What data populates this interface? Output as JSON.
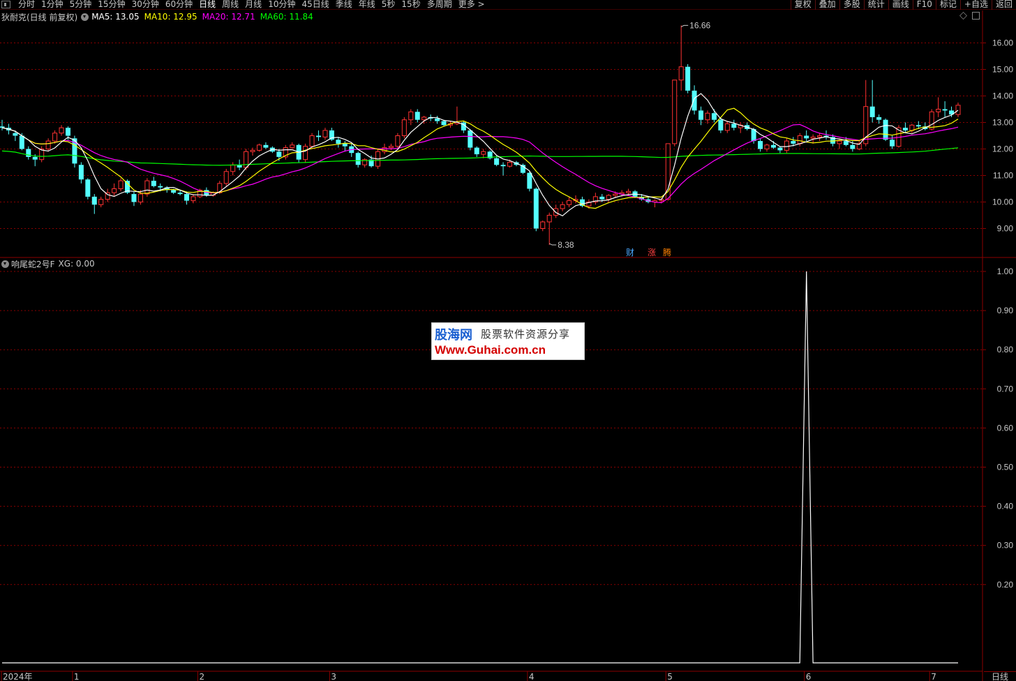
{
  "toolbar": {
    "timeframes": [
      "分时",
      "1分钟",
      "5分钟",
      "15分钟",
      "30分钟",
      "60分钟",
      "日线",
      "周线",
      "月线",
      "10分钟",
      "45日线",
      "季线",
      "年线",
      "5秒",
      "15秒",
      "多周期",
      "更多 >"
    ],
    "active_timeframe": "日线",
    "right_tools": [
      "复权",
      "叠加",
      "多股",
      "统计",
      "画线",
      "F10",
      "标记",
      "+自选",
      "返回"
    ]
  },
  "main_panel": {
    "stock_title": "狄耐克(日线 前复权)",
    "ma_legend": [
      {
        "label": "MA5: 13.05",
        "color": "#ffffff"
      },
      {
        "label": "MA10: 12.95",
        "color": "#ffff00"
      },
      {
        "label": "MA20: 12.71",
        "color": "#ff00ff"
      },
      {
        "label": "MA60: 11.84",
        "color": "#00ff00"
      }
    ],
    "high_label": "16.66",
    "low_label": "8.38",
    "event_marks": [
      {
        "text": "财",
        "color": "#4aa8ff"
      },
      {
        "text": "涨",
        "color": "#ff4040"
      },
      {
        "text": "腾",
        "color": "#ff8000"
      }
    ]
  },
  "sub_panel": {
    "indicator_title": "响尾蛇2号F",
    "indicator_value": "XG: 0.00"
  },
  "watermark": {
    "logo": "股海网",
    "subtitle": "股票软件资源分享",
    "url": "Www.Guhai.com.cn"
  },
  "bottom_tab": "日线",
  "colors": {
    "up": "#ff3232",
    "down": "#54ffff",
    "ma5": "#ffffff",
    "ma10": "#ffff00",
    "ma20": "#ff00ff",
    "ma60": "#00ff00",
    "grid": "#8b0000",
    "axis": "#c8c8c8"
  },
  "chart_data": [
    {
      "type": "candlestick",
      "title": "狄耐克(日线 前复权)",
      "ylim": [
        8.0,
        16.9
      ],
      "y_ticks": [
        9.0,
        10.0,
        11.0,
        12.0,
        13.0,
        14.0,
        15.0,
        16.0
      ],
      "grid": true,
      "candles": [
        [
          12.85,
          13.1,
          12.7,
          12.8
        ],
        [
          12.8,
          12.95,
          12.55,
          12.7
        ],
        [
          12.6,
          12.7,
          12.3,
          12.5
        ],
        [
          12.5,
          12.6,
          11.95,
          12.0
        ],
        [
          12.0,
          12.1,
          11.6,
          11.7
        ],
        [
          11.7,
          11.8,
          11.35,
          11.6
        ],
        [
          11.6,
          12.1,
          11.5,
          12.0
        ],
        [
          12.0,
          12.4,
          11.9,
          12.3
        ],
        [
          12.3,
          12.7,
          12.2,
          12.6
        ],
        [
          12.6,
          12.9,
          12.5,
          12.8
        ],
        [
          12.8,
          12.85,
          12.35,
          12.5
        ],
        [
          12.4,
          12.5,
          11.3,
          11.45
        ],
        [
          11.4,
          11.5,
          10.7,
          10.85
        ],
        [
          10.85,
          10.9,
          10.1,
          10.2
        ],
        [
          10.2,
          10.3,
          9.55,
          9.9
        ],
        [
          9.9,
          10.2,
          9.8,
          10.1
        ],
        [
          10.1,
          10.5,
          10.0,
          10.35
        ],
        [
          10.35,
          10.7,
          10.2,
          10.5
        ],
        [
          10.5,
          10.9,
          10.4,
          10.8
        ],
        [
          10.8,
          10.85,
          10.3,
          10.35
        ],
        [
          10.3,
          10.4,
          9.85,
          10.0
        ],
        [
          10.0,
          10.45,
          9.9,
          10.3
        ],
        [
          10.3,
          10.9,
          10.2,
          10.8
        ],
        [
          10.8,
          10.95,
          10.55,
          10.6
        ],
        [
          10.6,
          10.7,
          10.4,
          10.55
        ],
        [
          10.55,
          10.6,
          10.35,
          10.45
        ],
        [
          10.45,
          10.5,
          10.3,
          10.35
        ],
        [
          10.35,
          10.45,
          10.25,
          10.3
        ],
        [
          10.3,
          10.4,
          9.9,
          10.05
        ],
        [
          10.05,
          10.3,
          9.95,
          10.2
        ],
        [
          10.2,
          10.5,
          10.15,
          10.45
        ],
        [
          10.45,
          10.55,
          10.2,
          10.25
        ],
        [
          10.25,
          10.4,
          10.2,
          10.35
        ],
        [
          10.35,
          10.8,
          10.3,
          10.7
        ],
        [
          10.7,
          11.25,
          10.6,
          11.15
        ],
        [
          11.15,
          11.5,
          11.0,
          11.4
        ],
        [
          11.4,
          11.6,
          11.2,
          11.3
        ],
        [
          11.3,
          12.0,
          11.2,
          11.9
        ],
        [
          11.9,
          12.05,
          11.75,
          11.95
        ],
        [
          11.95,
          12.2,
          11.9,
          12.15
        ],
        [
          12.15,
          12.25,
          12.0,
          12.05
        ],
        [
          12.05,
          12.1,
          11.85,
          11.9
        ],
        [
          11.9,
          12.0,
          11.55,
          11.7
        ],
        [
          11.7,
          12.15,
          11.6,
          12.05
        ],
        [
          12.05,
          12.25,
          12.0,
          12.15
        ],
        [
          12.15,
          12.2,
          11.5,
          11.6
        ],
        [
          11.6,
          12.2,
          11.5,
          12.1
        ],
        [
          12.1,
          12.6,
          12.0,
          12.5
        ],
        [
          12.5,
          12.7,
          12.3,
          12.45
        ],
        [
          12.45,
          12.8,
          12.35,
          12.7
        ],
        [
          12.7,
          12.8,
          12.3,
          12.35
        ],
        [
          12.35,
          12.45,
          12.05,
          12.2
        ],
        [
          12.2,
          12.3,
          11.9,
          12.1
        ],
        [
          12.1,
          12.2,
          11.7,
          11.85
        ],
        [
          11.85,
          11.9,
          11.3,
          11.4
        ],
        [
          11.4,
          11.65,
          11.3,
          11.6
        ],
        [
          11.6,
          11.75,
          11.3,
          11.35
        ],
        [
          11.35,
          12.0,
          11.25,
          11.9
        ],
        [
          11.9,
          12.2,
          11.8,
          12.05
        ],
        [
          12.05,
          12.2,
          11.95,
          12.1
        ],
        [
          12.1,
          12.6,
          12.0,
          12.5
        ],
        [
          12.5,
          13.2,
          12.4,
          13.1
        ],
        [
          13.1,
          13.5,
          12.9,
          13.4
        ],
        [
          13.4,
          13.5,
          13.0,
          13.1
        ],
        [
          13.1,
          13.25,
          12.95,
          13.2
        ],
        [
          13.2,
          13.3,
          13.05,
          13.15
        ],
        [
          13.15,
          13.25,
          12.95,
          13.05
        ],
        [
          13.05,
          13.1,
          12.85,
          12.9
        ],
        [
          12.9,
          13.05,
          12.8,
          12.95
        ],
        [
          12.95,
          13.6,
          12.9,
          13.0
        ],
        [
          13.0,
          13.05,
          12.6,
          12.7
        ],
        [
          12.7,
          12.75,
          11.95,
          12.05
        ],
        [
          12.05,
          12.1,
          11.7,
          11.8
        ],
        [
          11.8,
          12.0,
          11.65,
          11.9
        ],
        [
          11.9,
          11.95,
          11.6,
          11.65
        ],
        [
          11.65,
          11.75,
          11.35,
          11.4
        ],
        [
          11.4,
          11.5,
          11.0,
          11.35
        ],
        [
          11.35,
          11.6,
          11.3,
          11.5
        ],
        [
          11.5,
          11.55,
          11.35,
          11.4
        ],
        [
          11.4,
          11.45,
          11.05,
          11.1
        ],
        [
          11.1,
          11.15,
          10.4,
          10.5
        ],
        [
          10.5,
          10.55,
          8.9,
          9.0
        ],
        [
          9.0,
          9.3,
          8.9,
          9.25
        ],
        [
          9.25,
          9.6,
          8.38,
          9.5
        ],
        [
          9.5,
          9.9,
          9.4,
          9.75
        ],
        [
          9.75,
          10.0,
          9.65,
          9.9
        ],
        [
          9.9,
          10.2,
          9.8,
          10.05
        ],
        [
          10.05,
          10.25,
          9.95,
          10.1
        ],
        [
          10.1,
          10.2,
          9.8,
          9.85
        ],
        [
          9.85,
          10.1,
          9.75,
          10.0
        ],
        [
          10.0,
          10.35,
          9.9,
          10.2
        ],
        [
          10.2,
          10.3,
          10.0,
          10.1
        ],
        [
          10.1,
          10.3,
          10.0,
          10.25
        ],
        [
          10.25,
          10.4,
          10.15,
          10.3
        ],
        [
          10.3,
          10.45,
          10.2,
          10.35
        ],
        [
          10.35,
          10.5,
          10.25,
          10.4
        ],
        [
          10.4,
          10.45,
          10.15,
          10.2
        ],
        [
          10.2,
          10.3,
          10.05,
          10.1
        ],
        [
          10.1,
          10.2,
          9.95,
          10.0
        ],
        [
          10.0,
          10.1,
          9.8,
          10.05
        ],
        [
          10.05,
          10.15,
          9.95,
          10.1
        ],
        [
          10.1,
          12.2,
          10.05,
          12.2
        ],
        [
          12.2,
          14.6,
          12.1,
          14.6
        ],
        [
          14.6,
          16.66,
          14.2,
          15.1
        ],
        [
          15.1,
          15.2,
          14.1,
          14.2
        ],
        [
          14.2,
          14.4,
          13.3,
          13.45
        ],
        [
          13.45,
          13.6,
          12.9,
          13.1
        ],
        [
          13.1,
          13.45,
          12.95,
          13.35
        ],
        [
          13.35,
          13.5,
          13.0,
          13.1
        ],
        [
          13.1,
          13.2,
          12.6,
          12.7
        ],
        [
          12.7,
          13.05,
          12.6,
          12.95
        ],
        [
          12.95,
          13.1,
          12.7,
          12.8
        ],
        [
          12.8,
          13.0,
          12.6,
          12.9
        ],
        [
          12.9,
          13.0,
          12.7,
          12.75
        ],
        [
          12.75,
          12.8,
          12.2,
          12.3
        ],
        [
          12.3,
          12.4,
          11.9,
          12.0
        ],
        [
          12.0,
          12.2,
          11.9,
          12.15
        ],
        [
          12.15,
          12.3,
          12.0,
          12.05
        ],
        [
          12.05,
          12.1,
          11.85,
          11.95
        ],
        [
          11.95,
          12.4,
          11.85,
          12.3
        ],
        [
          12.3,
          12.45,
          12.1,
          12.2
        ],
        [
          12.2,
          12.6,
          12.1,
          12.5
        ],
        [
          12.5,
          12.7,
          12.3,
          12.4
        ],
        [
          12.4,
          12.55,
          12.2,
          12.45
        ],
        [
          12.45,
          12.6,
          12.3,
          12.5
        ],
        [
          12.5,
          12.7,
          12.35,
          12.45
        ],
        [
          12.45,
          12.55,
          12.1,
          12.2
        ],
        [
          12.2,
          12.4,
          12.0,
          12.3
        ],
        [
          12.3,
          12.45,
          12.1,
          12.15
        ],
        [
          12.15,
          12.3,
          11.9,
          12.0
        ],
        [
          12.0,
          12.3,
          11.95,
          12.2
        ],
        [
          12.2,
          14.6,
          12.1,
          13.6
        ],
        [
          13.6,
          14.6,
          13.0,
          13.2
        ],
        [
          13.2,
          13.3,
          12.95,
          13.1
        ],
        [
          13.1,
          13.15,
          12.3,
          12.35
        ],
        [
          12.35,
          12.5,
          12.0,
          12.1
        ],
        [
          12.1,
          12.9,
          12.05,
          12.8
        ],
        [
          12.8,
          13.0,
          12.6,
          12.7
        ],
        [
          12.7,
          12.95,
          12.6,
          12.9
        ],
        [
          12.9,
          13.05,
          12.75,
          12.85
        ],
        [
          12.85,
          13.0,
          12.7,
          12.75
        ],
        [
          12.75,
          13.5,
          12.7,
          13.4
        ],
        [
          13.4,
          13.95,
          13.2,
          13.5
        ],
        [
          13.5,
          13.8,
          13.2,
          13.45
        ],
        [
          13.45,
          13.6,
          13.2,
          13.3
        ],
        [
          13.3,
          13.75,
          13.2,
          13.65
        ]
      ],
      "moving_averages": [
        "MA5",
        "MA10",
        "MA20",
        "MA60"
      ],
      "annotations": [
        {
          "text": "16.66",
          "kind": "high"
        },
        {
          "text": "8.38",
          "kind": "low"
        }
      ]
    },
    {
      "type": "line",
      "title": "响尾蛇2号F",
      "ylim": [
        0.0,
        1.0
      ],
      "y_ticks": [
        0.2,
        0.3,
        0.4,
        0.5,
        0.6,
        0.7,
        0.8,
        0.9,
        1.0
      ],
      "x_tick_labels": [
        "2024年",
        "1",
        "2",
        "3",
        "4",
        "5",
        "6",
        "7"
      ],
      "series": [
        {
          "name": "XG",
          "signal_index": 122,
          "signal_value": 1.0,
          "baseline_value": 0.0
        }
      ],
      "grid": true
    }
  ]
}
